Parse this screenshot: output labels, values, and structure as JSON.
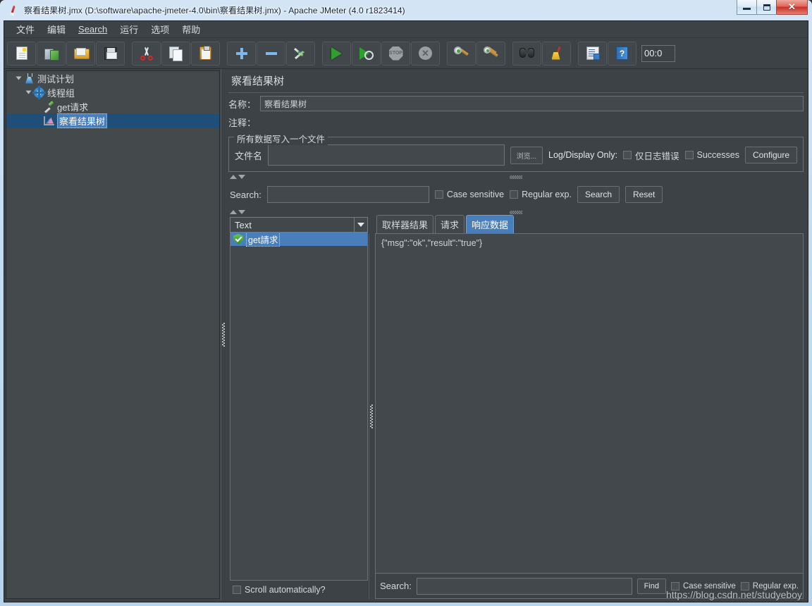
{
  "window": {
    "title": "察看结果树.jmx (D:\\software\\apache-jmeter-4.0\\bin\\察看结果树.jmx) - Apache JMeter (4.0 r1823414)",
    "app_icon": "jmeter-feather-icon",
    "controls": {
      "minimize": "–",
      "maximize": "□",
      "close": "✕"
    }
  },
  "menubar": {
    "items": [
      {
        "label": "文件",
        "name": "menu-file"
      },
      {
        "label": "编辑",
        "name": "menu-edit"
      },
      {
        "label": "Search",
        "name": "menu-search",
        "mnemonic": "S"
      },
      {
        "label": "运行",
        "name": "menu-run"
      },
      {
        "label": "选项",
        "name": "menu-options"
      },
      {
        "label": "帮助",
        "name": "menu-help"
      }
    ]
  },
  "toolbar": {
    "buttons": [
      {
        "icon": "new-document-icon",
        "name": "toolbar-new"
      },
      {
        "icon": "templates-icon",
        "name": "toolbar-templates"
      },
      {
        "icon": "open-folder-icon",
        "name": "toolbar-open"
      },
      {
        "icon": "save-floppy-icon",
        "name": "toolbar-save"
      },
      {
        "icon": "cut-scissors-icon",
        "name": "toolbar-cut"
      },
      {
        "icon": "copy-pages-icon",
        "name": "toolbar-copy"
      },
      {
        "icon": "paste-clipboard-icon",
        "name": "toolbar-paste"
      },
      {
        "icon": "plus-icon",
        "name": "toolbar-expand-all"
      },
      {
        "icon": "minus-icon",
        "name": "toolbar-collapse-all"
      },
      {
        "icon": "toggle-icon",
        "name": "toolbar-toggle"
      },
      {
        "icon": "start-play-icon",
        "name": "toolbar-start"
      },
      {
        "icon": "start-no-timers-icon",
        "name": "toolbar-start-no-pauses"
      },
      {
        "icon": "stop-icon",
        "name": "toolbar-stop"
      },
      {
        "icon": "shutdown-icon",
        "name": "toolbar-shutdown"
      },
      {
        "icon": "clear-icon",
        "name": "toolbar-clear"
      },
      {
        "icon": "clear-all-icon",
        "name": "toolbar-clear-all"
      },
      {
        "icon": "binoculars-search-icon",
        "name": "toolbar-search"
      },
      {
        "icon": "broom-reset-icon",
        "name": "toolbar-reset-search"
      },
      {
        "icon": "function-helper-icon",
        "name": "toolbar-function-helper"
      },
      {
        "icon": "help-book-icon",
        "name": "toolbar-help"
      }
    ],
    "timer": "00:0"
  },
  "tree": {
    "nodes": [
      {
        "label": "测试计划",
        "icon": "flask-icon",
        "depth": 0,
        "expanded": true,
        "selected": false,
        "name": "tree-node-test-plan"
      },
      {
        "label": "线程组",
        "icon": "gear-icon",
        "depth": 1,
        "expanded": true,
        "selected": false,
        "name": "tree-node-thread-group"
      },
      {
        "label": "get请求",
        "icon": "pipette-icon",
        "depth": 2,
        "expanded": false,
        "selected": false,
        "name": "tree-node-get-request"
      },
      {
        "label": "察看结果树",
        "icon": "chart-icon",
        "depth": 2,
        "expanded": false,
        "selected": true,
        "name": "tree-node-view-results-tree"
      }
    ]
  },
  "panel": {
    "title": "察看结果树",
    "name_label": "名称：",
    "name_value": "察看结果树",
    "comment_label": "注释：",
    "comment_value": ""
  },
  "file_group": {
    "legend": "所有数据写入一个文件",
    "filename_label": "文件名",
    "filename_value": "",
    "browse_label": "浏览...",
    "log_display_only_label": "Log/Display Only:",
    "errors_only_label": "仅日志错误",
    "successes_label": "Successes",
    "configure_label": "Configure"
  },
  "search_top": {
    "label": "Search:",
    "value": "",
    "case_sensitive_label": "Case sensitive",
    "regular_exp_label": "Regular exp.",
    "search_button": "Search",
    "reset_button": "Reset"
  },
  "results": {
    "renderer_selected": "Text",
    "items": [
      {
        "label": "get請求",
        "status": "success-shield-icon",
        "selected": true
      }
    ],
    "scroll_automatically_label": "Scroll automatically?",
    "tabs": [
      {
        "label": "取样器结果",
        "active": false,
        "name": "tab-sampler-result"
      },
      {
        "label": "请求",
        "active": false,
        "name": "tab-request"
      },
      {
        "label": "响应数据",
        "active": true,
        "name": "tab-response-data"
      }
    ],
    "response_body": "{\"msg\":\"ok\",\"result\":\"true\"}"
  },
  "search_bottom": {
    "label": "Search:",
    "value": "",
    "find_button": "Find",
    "case_sensitive_label": "Case sensitive",
    "regular_exp_label": "Regular exp."
  },
  "watermark": "https://blog.csdn.net/studyeboy",
  "colors": {
    "accent_blue": "#4a7ebb",
    "panel_bg": "#3c4245",
    "field_bg": "#42484b",
    "text": "#d6dbde",
    "selection": "#1f4e79"
  }
}
